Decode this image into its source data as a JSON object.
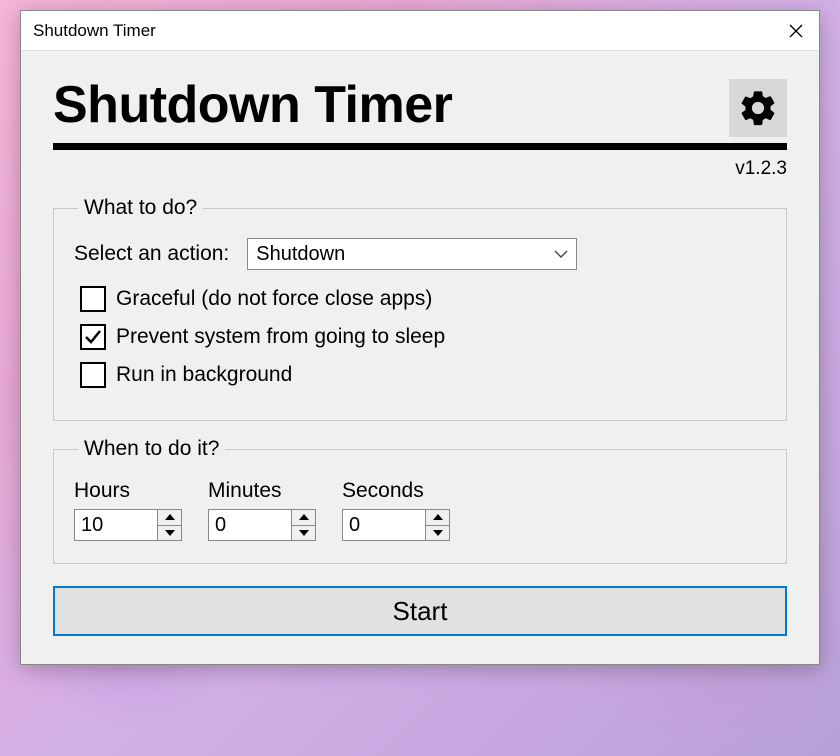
{
  "titlebar": {
    "title": "Shutdown Timer"
  },
  "header": {
    "app_title": "Shutdown Timer",
    "version": "v1.2.3"
  },
  "what": {
    "legend": "What to do?",
    "select_label": "Select an action:",
    "select_value": "Shutdown",
    "graceful_label": "Graceful (do not force close apps)",
    "graceful_checked": false,
    "prevent_sleep_label": "Prevent system from going to sleep",
    "prevent_sleep_checked": true,
    "run_bg_label": "Run in background",
    "run_bg_checked": false
  },
  "when": {
    "legend": "When to do it?",
    "hours_label": "Hours",
    "hours_value": "10",
    "minutes_label": "Minutes",
    "minutes_value": "0",
    "seconds_label": "Seconds",
    "seconds_value": "0"
  },
  "start": {
    "label": "Start"
  }
}
